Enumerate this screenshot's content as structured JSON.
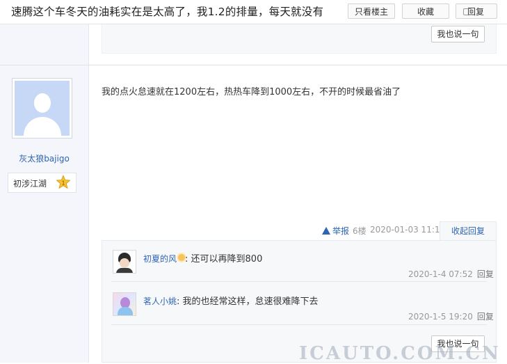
{
  "thread": {
    "title": "速腾这个车冬天的油耗实在是太高了，我1.2的排量，每天就没有",
    "only_owner_label": "只看楼主",
    "favorite_label": "收藏",
    "reply_label": "回复"
  },
  "prev_post": {
    "say_label": "我也说一句"
  },
  "post": {
    "user": {
      "name": "灰太狼bajigo",
      "level_title": "初涉江湖",
      "level_number": "1"
    },
    "content": "我的点火怠速就在1200左右，热热车降到1000左右，不开的时候最省油了",
    "report_label": "举报",
    "floor": "6楼",
    "time": "2020-01-03 11:14",
    "collapse_label": "收起回复"
  },
  "replies": [
    {
      "name": "初夏的风",
      "text": ": 还可以再降到800",
      "time": "2020-1-4 07:52",
      "reply_label": "回复"
    },
    {
      "name": "茗人小姚",
      "text": ": 我的也经常这样，怠速很难降下去",
      "time": "2020-1-5 19:20",
      "reply_label": "回复"
    }
  ],
  "say_label": "我也说一句",
  "watermark": "ICAUTO.COM.CN",
  "colors": {
    "link": "#2d64b3",
    "sidebar_bg": "#f4f6fb",
    "reply_bg": "#f7f8fa",
    "star": "#f6c231"
  },
  "icons": [
    "warning-triangle-icon",
    "comment-icon",
    "star-level-icon",
    "sun-badge-icon"
  ]
}
